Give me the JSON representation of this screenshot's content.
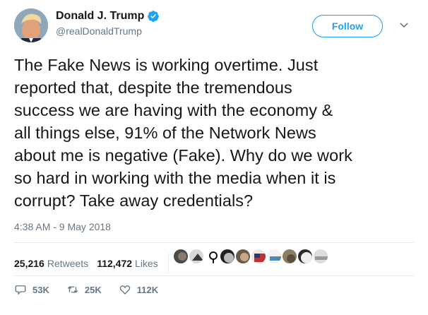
{
  "user": {
    "display_name": "Donald J. Trump",
    "handle": "@realDonaldTrump",
    "verified": true,
    "follow_label": "Follow"
  },
  "tweet": {
    "lines": [
      "The Fake News is working overtime. Just",
      "reported that, despite the tremendous",
      "success we are having with the economy &",
      "all things else, 91% of the Network News",
      "about me is negative (Fake). Why do we work",
      "so hard in working with the media when it is",
      "corrupt? Take away credentials?"
    ],
    "timestamp": "4:38 AM - 9 May 2018"
  },
  "stats": {
    "retweets_count": "25,216",
    "retweets_label": "Retweets",
    "likes_count": "112,472",
    "likes_label": "Likes"
  },
  "actions": {
    "reply_count": "53K",
    "retweet_count": "25K",
    "like_count": "112K"
  },
  "colors": {
    "accent": "#1da1f2",
    "secondary_text": "#657786",
    "divider": "#e6ecf0"
  },
  "icons": [
    "verified-badge-icon",
    "chevron-down-icon",
    "reply-icon",
    "retweet-icon",
    "heart-icon"
  ]
}
